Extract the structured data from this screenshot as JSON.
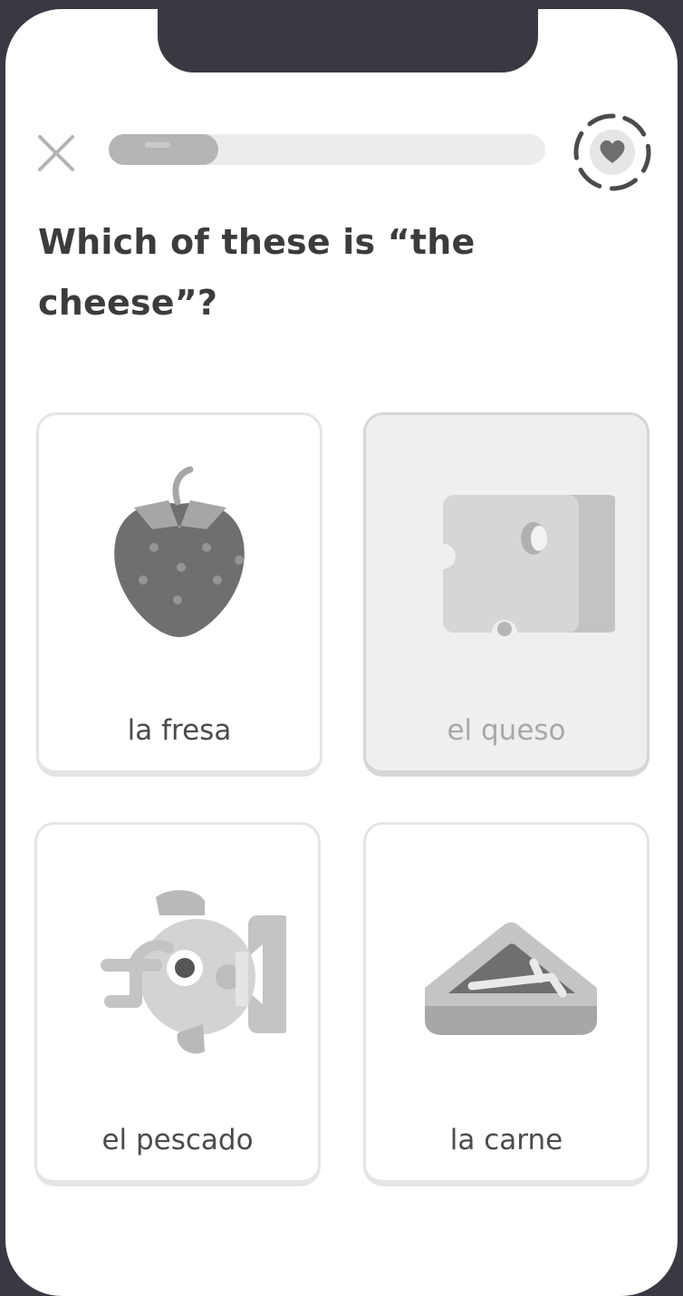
{
  "progress": {
    "fraction": 0.25
  },
  "question": {
    "text": "Which of these is “the cheese”?"
  },
  "choices": [
    {
      "label": "la fresa",
      "icon": "strawberry-icon",
      "selected": false
    },
    {
      "label": "el queso",
      "icon": "cheese-icon",
      "selected": true
    },
    {
      "label": "el pescado",
      "icon": "fish-icon",
      "selected": false
    },
    {
      "label": "la carne",
      "icon": "steak-icon",
      "selected": false
    }
  ],
  "colors": {
    "frame": "#3b3842",
    "text": "#3c3c3c",
    "card_border": "#e5e5e5",
    "selected_card_bg": "#efefef",
    "progress_track": "#ececec",
    "progress_fill": "#b5b5b5"
  }
}
